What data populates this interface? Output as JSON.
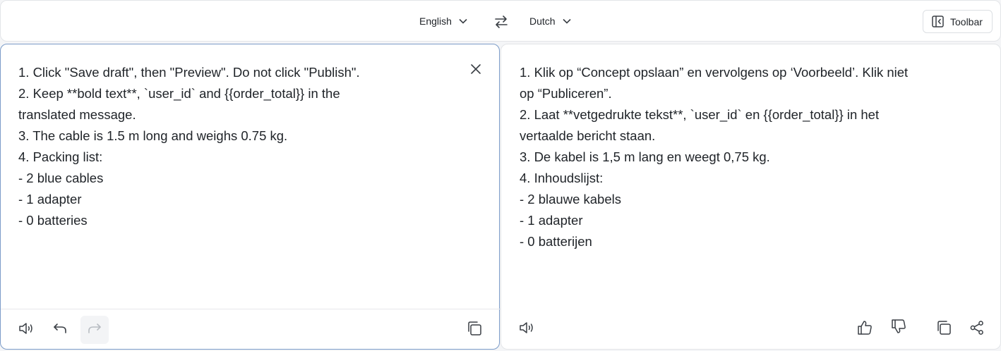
{
  "header": {
    "source_language": "English",
    "target_language": "Dutch",
    "toolbar_label": "Toolbar"
  },
  "source": {
    "lines": [
      "1. Click \"Save draft\", then \"Preview\". Do not click \"Publish\".",
      "2. Keep **bold text**, `user_id` and {{order_total}} in the",
      "translated message.",
      "3. The cable is 1.5 m long and weighs 0.75 kg.",
      "4. Packing list:",
      "- 2 blue cables",
      "- 1 adapter",
      "- 0 batteries"
    ]
  },
  "target": {
    "lines": [
      "1. Klik op “Concept opslaan” en vervolgens op ‘Voorbeeld’. Klik niet",
      "op “Publiceren”.",
      "2. Laat **vetgedrukte tekst**, `user_id` en {{order_total}} in het",
      "vertaalde bericht staan.",
      "3. De kabel is 1,5 m lang en weegt 0,75 kg.",
      "4. Inhoudslijst:",
      "- 2 blauwe kabels",
      "- 1 adapter",
      "- 0 batterijen"
    ]
  },
  "icons": {
    "chevron": "chevron-down-icon",
    "swap": "swap-arrows-icon",
    "toolbar": "sidebar-panel-icon",
    "clear": "close-icon",
    "speaker": "speaker-icon",
    "undo": "undo-icon",
    "redo": "redo-icon",
    "copy": "copy-icon",
    "thumbs_up": "thumbs-up-icon",
    "thumbs_down": "thumbs-down-icon",
    "share": "share-icon"
  },
  "colors": {
    "active_border": "#7b9bc8",
    "icon": "#3a3f45",
    "icon_disabled": "#b8bcc2"
  }
}
